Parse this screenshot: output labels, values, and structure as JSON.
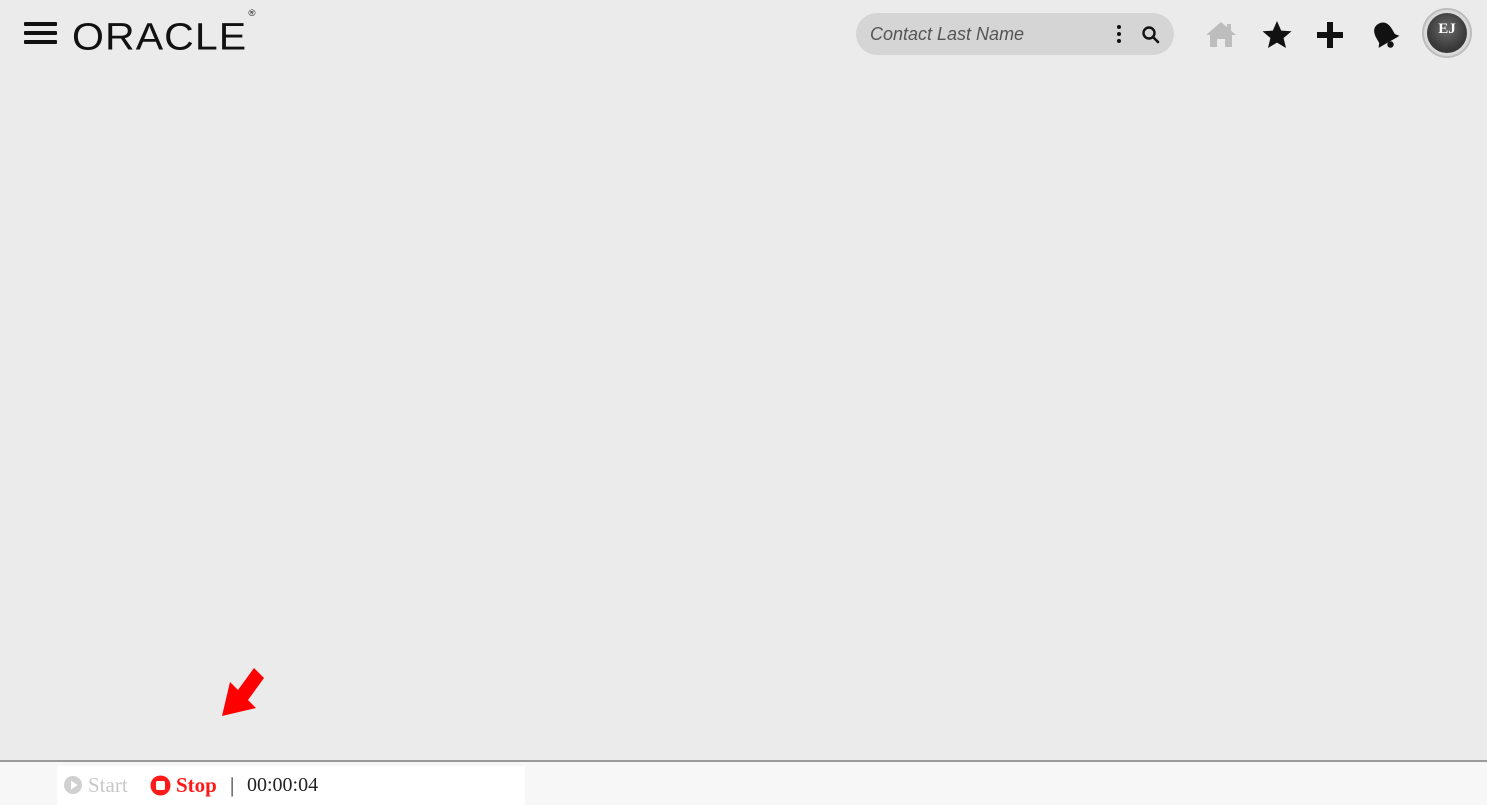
{
  "header": {
    "brand": "ORACLE",
    "brand_mark": "®",
    "search": {
      "placeholder": "Contact Last Name",
      "value": ""
    },
    "icons": {
      "menu": "hamburger-menu-icon",
      "options": "kebab-icon",
      "search": "search-icon",
      "home": "home-icon",
      "favorites": "star-icon",
      "create": "plus-icon",
      "notifications": "bell-icon"
    },
    "user": {
      "initials": "EJ"
    }
  },
  "recorder": {
    "start_label": "Start",
    "stop_label": "Stop",
    "separator": "|",
    "elapsed": "00:00:04"
  },
  "colors": {
    "background": "#ebebeb",
    "search_bg": "#d5d5d5",
    "stop_red": "#ff1a1a",
    "start_disabled": "#c8c8c8",
    "arrow_red": "#ff0000",
    "home_disabled": "#bdbdbd"
  }
}
